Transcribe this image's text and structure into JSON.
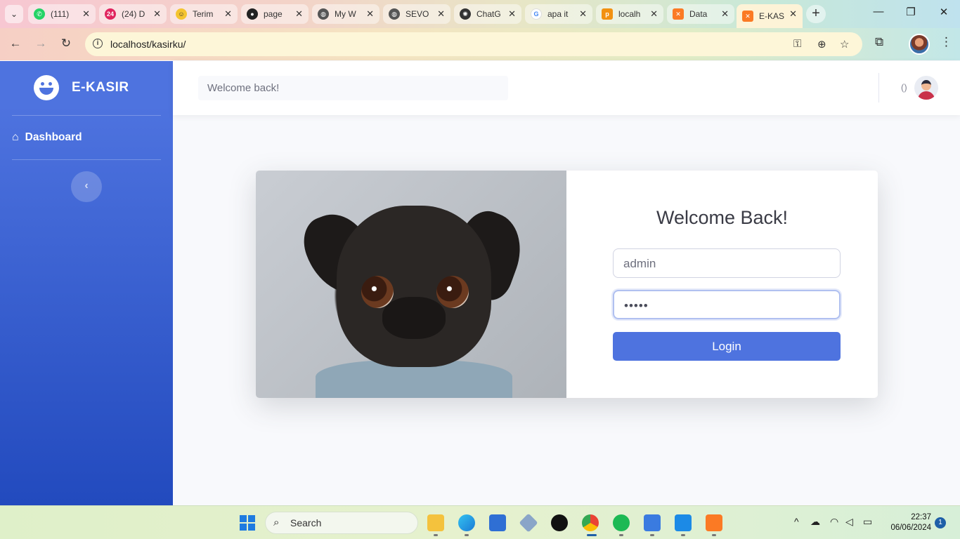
{
  "browser": {
    "tabs": [
      {
        "label": "(111)",
        "icon": "whatsapp-icon",
        "color": "#25d366"
      },
      {
        "label": "(24) D",
        "icon": "notification-24-icon",
        "color": "#e0245e"
      },
      {
        "label": "Terim",
        "icon": "emoji-icon",
        "color": "#f4c430"
      },
      {
        "label": "page",
        "icon": "github-icon",
        "color": "#222222"
      },
      {
        "label": "My W",
        "icon": "globe-icon",
        "color": "#555555"
      },
      {
        "label": "SEVO",
        "icon": "globe-icon",
        "color": "#555555"
      },
      {
        "label": "ChatG",
        "icon": "openai-icon",
        "color": "#333333"
      },
      {
        "label": "apa it",
        "icon": "google-icon",
        "color": "#4285f4"
      },
      {
        "label": "localh",
        "icon": "phpmyadmin-icon",
        "color": "#f29111"
      },
      {
        "label": "Data",
        "icon": "xampp-icon",
        "color": "#fb7a24"
      },
      {
        "label": "E-KAS",
        "icon": "xampp-icon",
        "color": "#fb7a24"
      }
    ],
    "url": "localhost/kasirku/"
  },
  "sidebar": {
    "brand": "E-KASIR",
    "nav_dashboard": "Dashboard"
  },
  "topbar": {
    "search_text": "Welcome back!",
    "user_name": "()"
  },
  "login": {
    "title": "Welcome Back!",
    "username": "admin",
    "password_mask": "•••••",
    "button": "Login"
  },
  "taskbar": {
    "search_label": "Search",
    "time": "22:37",
    "date": "06/06/2024",
    "notification_count": "1"
  },
  "colors": {
    "primary": "#4e73df",
    "sidebar_dark": "#224abe"
  }
}
